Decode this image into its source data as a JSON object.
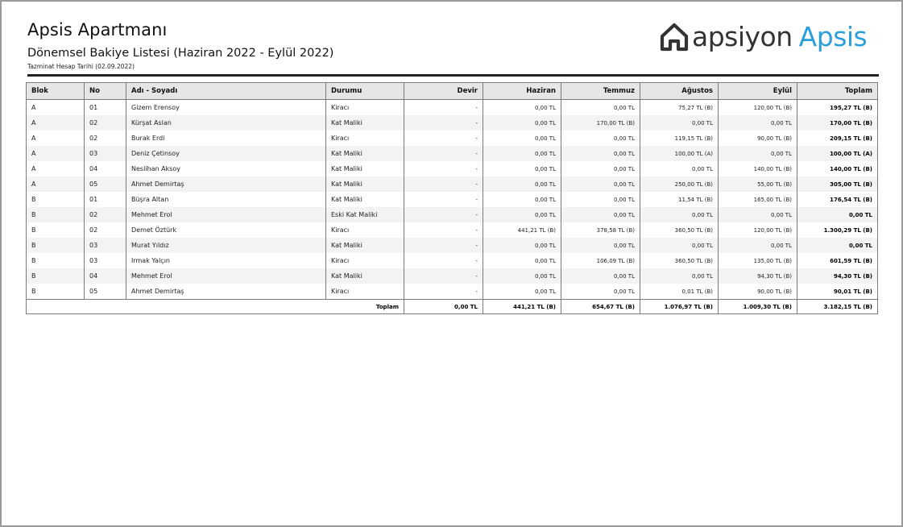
{
  "header": {
    "title": "Apsis Apartmanı",
    "subtitle": "Dönemsel Bakiye Listesi (Haziran 2022 - Eylül 2022)",
    "note": "Tazminat Hesap Tarihi (02.09.2022)"
  },
  "logo": {
    "word1": "apsiyon",
    "word2": "Apsis",
    "icon": "house-icon",
    "brand_color": "#2b9fd9"
  },
  "table": {
    "columns": [
      "Blok",
      "No",
      "Adı - Soyadı",
      "Durumu",
      "Devir",
      "Haziran",
      "Temmuz",
      "Ağustos",
      "Eylül",
      "Toplam"
    ],
    "rows": [
      [
        "A",
        "01",
        "Gizem Erensoy",
        "Kiracı",
        "-",
        "0,00 TL",
        "0,00 TL",
        "75,27 TL (B)",
        "120,00 TL (B)",
        "195,27 TL (B)"
      ],
      [
        "A",
        "02",
        "Kürşat Aslan",
        "Kat Maliki",
        "-",
        "0,00 TL",
        "170,00 TL (B)",
        "0,00 TL",
        "0,00 TL",
        "170,00 TL (B)"
      ],
      [
        "A",
        "02",
        "Burak Erdi",
        "Kiracı",
        "-",
        "0,00 TL",
        "0,00 TL",
        "119,15 TL (B)",
        "90,00 TL (B)",
        "209,15 TL (B)"
      ],
      [
        "A",
        "03",
        "Deniz Çetinsoy",
        "Kat Maliki",
        "-",
        "0,00 TL",
        "0,00 TL",
        "100,00 TL (A)",
        "0,00 TL",
        "100,00 TL (A)"
      ],
      [
        "A",
        "04",
        "Neslihan Aksoy",
        "Kat Maliki",
        "-",
        "0,00 TL",
        "0,00 TL",
        "0,00 TL",
        "140,00 TL (B)",
        "140,00 TL (B)"
      ],
      [
        "A",
        "05",
        "Ahmet Demirtaş",
        "Kat Maliki",
        "-",
        "0,00 TL",
        "0,00 TL",
        "250,00 TL (B)",
        "55,00 TL (B)",
        "305,00 TL (B)"
      ],
      [
        "B",
        "01",
        "Büşra Altan",
        "Kat Maliki",
        "-",
        "0,00 TL",
        "0,00 TL",
        "11,54 TL (B)",
        "165,00 TL (B)",
        "176,54 TL (B)"
      ],
      [
        "B",
        "02",
        "Mehmet Erol",
        "Eski Kat Maliki",
        "-",
        "0,00 TL",
        "0,00 TL",
        "0,00 TL",
        "0,00 TL",
        "0,00 TL"
      ],
      [
        "B",
        "02",
        "Demet Öztürk",
        "Kiracı",
        "-",
        "441,21 TL (B)",
        "378,58 TL (B)",
        "360,50 TL (B)",
        "120,00 TL (B)",
        "1.300,29 TL (B)"
      ],
      [
        "B",
        "03",
        "Murat Yıldız",
        "Kat Maliki",
        "-",
        "0,00 TL",
        "0,00 TL",
        "0,00 TL",
        "0,00 TL",
        "0,00 TL"
      ],
      [
        "B",
        "03",
        "Irmak Yalçın",
        "Kiracı",
        "-",
        "0,00 TL",
        "106,09 TL (B)",
        "360,50 TL (B)",
        "135,00 TL (B)",
        "601,59 TL (B)"
      ],
      [
        "B",
        "04",
        "Mehmet Erol",
        "Kat Maliki",
        "-",
        "0,00 TL",
        "0,00 TL",
        "0,00 TL",
        "94,30 TL (B)",
        "94,30 TL (B)"
      ],
      [
        "B",
        "05",
        "Ahmet Demirtaş",
        "Kiracı",
        "-",
        "0,00 TL",
        "0,00 TL",
        "0,01 TL (B)",
        "90,00 TL (B)",
        "90,01 TL (B)"
      ]
    ],
    "footer": {
      "label": "Toplam",
      "values": [
        "0,00 TL",
        "441,21 TL (B)",
        "654,67 TL (B)",
        "1.076,97 TL (B)",
        "1.009,30 TL (B)",
        "3.182,15 TL (B)"
      ]
    }
  }
}
